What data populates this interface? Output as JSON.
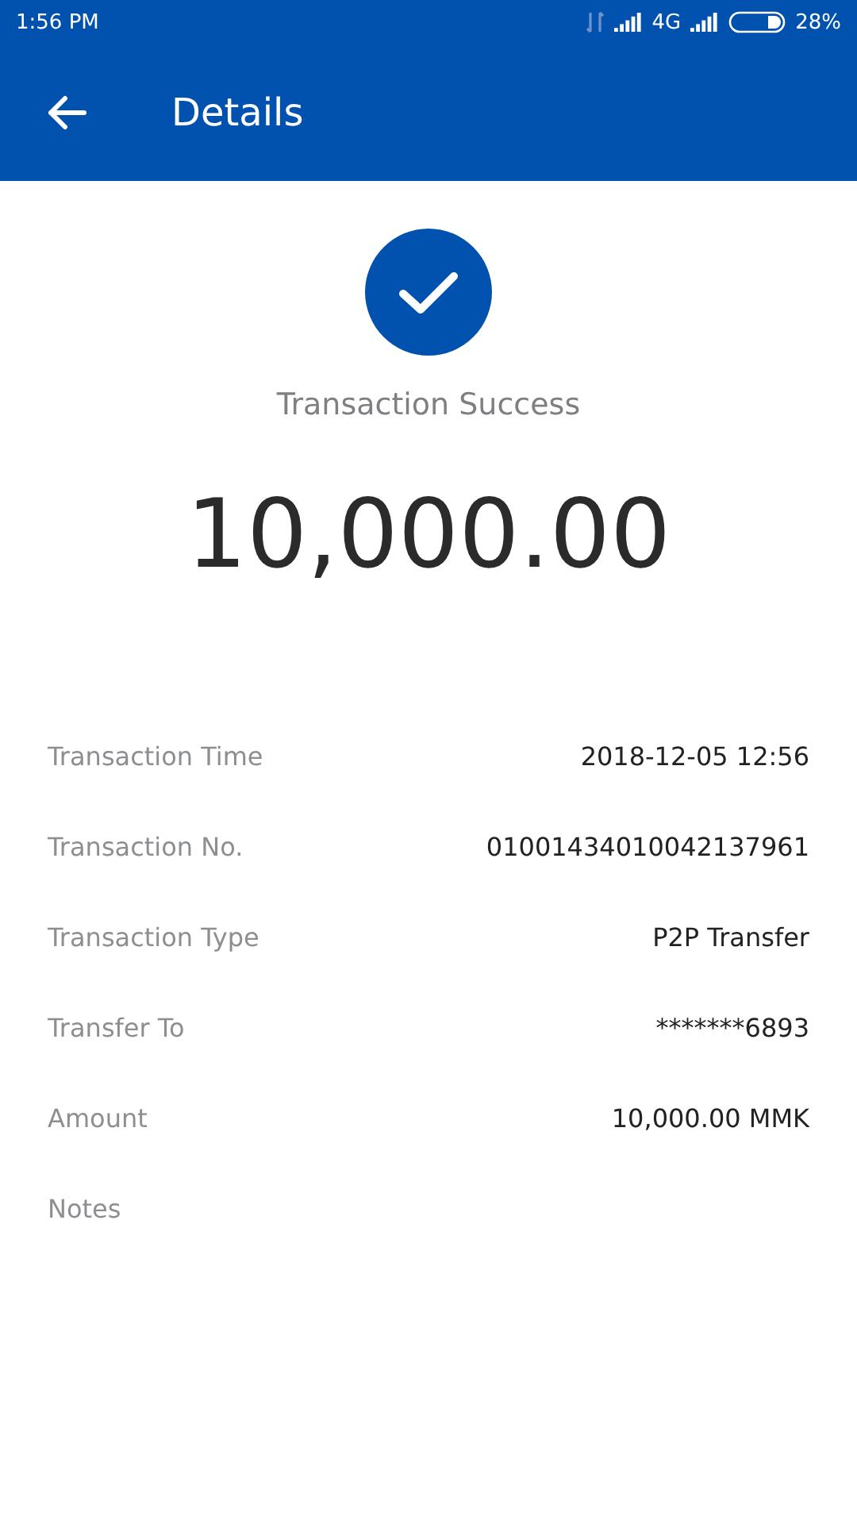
{
  "status_bar": {
    "time": "1:56 PM",
    "network": "4G",
    "battery": "28%"
  },
  "app_bar": {
    "title": "Details"
  },
  "result": {
    "message": "Transaction Success",
    "amount": "10,000.00"
  },
  "details": [
    {
      "label": "Transaction Time",
      "value": "2018-12-05 12:56"
    },
    {
      "label": "Transaction No.",
      "value": "01001434010042137961"
    },
    {
      "label": "Transaction Type",
      "value": "P2P Transfer"
    },
    {
      "label": "Transfer To",
      "value": "*******6893"
    },
    {
      "label": "Amount",
      "value": "10,000.00 MMK"
    },
    {
      "label": "Notes"
    }
  ]
}
